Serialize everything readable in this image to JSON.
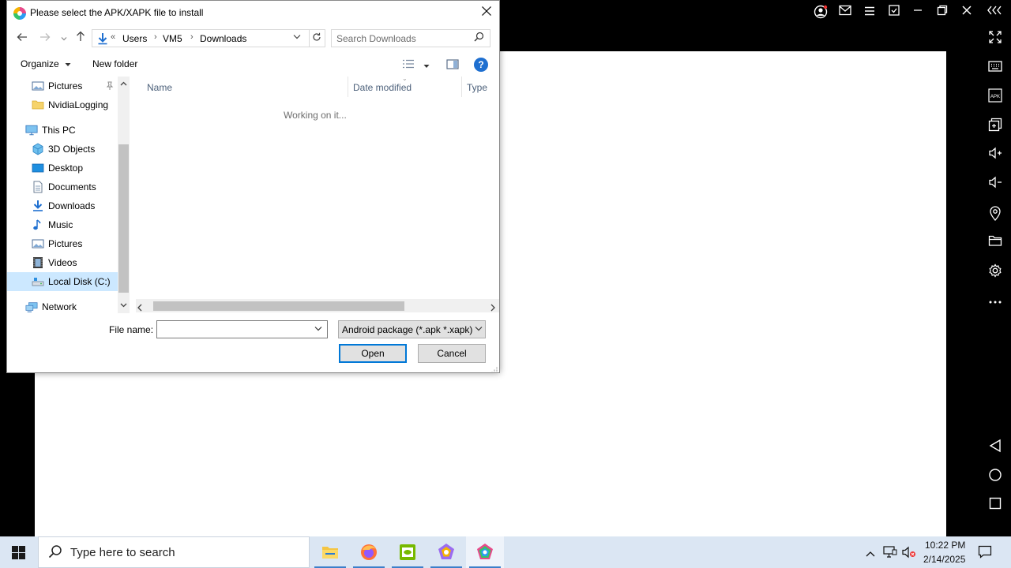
{
  "dialog": {
    "title": "Please select the APK/XAPK file to install",
    "breadcrumbs": [
      "Users",
      "VM5",
      "Downloads"
    ],
    "overflow_marker": "«",
    "search_placeholder": "Search Downloads",
    "commands": {
      "organize": "Organize",
      "new_folder": "New folder"
    },
    "nav_items": [
      {
        "label": "Pictures",
        "icon": "pictures-icon",
        "pinned": true
      },
      {
        "label": "NvidiaLogging",
        "icon": "folder-icon"
      },
      {
        "label": "This PC",
        "icon": "computer-icon"
      },
      {
        "label": "3D Objects",
        "icon": "3d-objects-icon"
      },
      {
        "label": "Desktop",
        "icon": "desktop-icon"
      },
      {
        "label": "Documents",
        "icon": "documents-icon"
      },
      {
        "label": "Downloads",
        "icon": "downloads-icon"
      },
      {
        "label": "Music",
        "icon": "music-icon"
      },
      {
        "label": "Pictures",
        "icon": "pictures-icon"
      },
      {
        "label": "Videos",
        "icon": "videos-icon"
      },
      {
        "label": "Local Disk (C:)",
        "icon": "drive-icon",
        "selected": true
      },
      {
        "label": "Network",
        "icon": "network-icon"
      }
    ],
    "columns": [
      "Name",
      "Date modified",
      "Type"
    ],
    "status_text": "Working on it...",
    "file_name_label": "File name:",
    "file_name_value": "",
    "file_type": "Android package (*.apk *.xapk)",
    "open_label": "Open",
    "cancel_label": "Cancel"
  },
  "side_toolbar": [
    "fullscreen-icon",
    "keyboard-icon",
    "apk-icon",
    "multi-instance-icon",
    "volume-up-icon",
    "volume-down-icon",
    "location-icon",
    "folder-icon",
    "settings-icon",
    "more-icon",
    "back-icon",
    "home-icon",
    "recents-icon"
  ],
  "side_toolbar_apk_label": "APK",
  "taskbar": {
    "search_placeholder": "Type here to search",
    "time": "10:22 PM",
    "date": "2/14/2025"
  },
  "colors": {
    "accent": "#0078d7",
    "selection": "#cce8ff",
    "taskbar": "#dbe6f3"
  }
}
